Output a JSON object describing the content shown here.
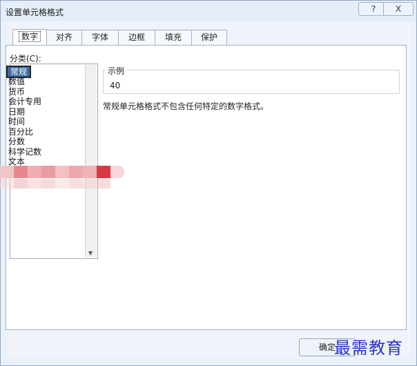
{
  "window": {
    "title": "设置单元格格式",
    "help_label": "?",
    "close_label": "X"
  },
  "tabs": [
    {
      "label": "数字"
    },
    {
      "label": "对齐"
    },
    {
      "label": "字体"
    },
    {
      "label": "边框"
    },
    {
      "label": "填充"
    },
    {
      "label": "保护"
    }
  ],
  "category": {
    "label": "分类(C):",
    "items": [
      "常规",
      "数值",
      "货币",
      "会计专用",
      "日期",
      "时间",
      "百分比",
      "分数",
      "科学记数",
      "文本"
    ],
    "selected": "常规"
  },
  "sample": {
    "legend": "示例",
    "value": "40"
  },
  "description": "常规单元格格式不包含任何特定的数字格式。",
  "buttons": {
    "ok_label": "确定"
  },
  "watermark": "最需教育"
}
